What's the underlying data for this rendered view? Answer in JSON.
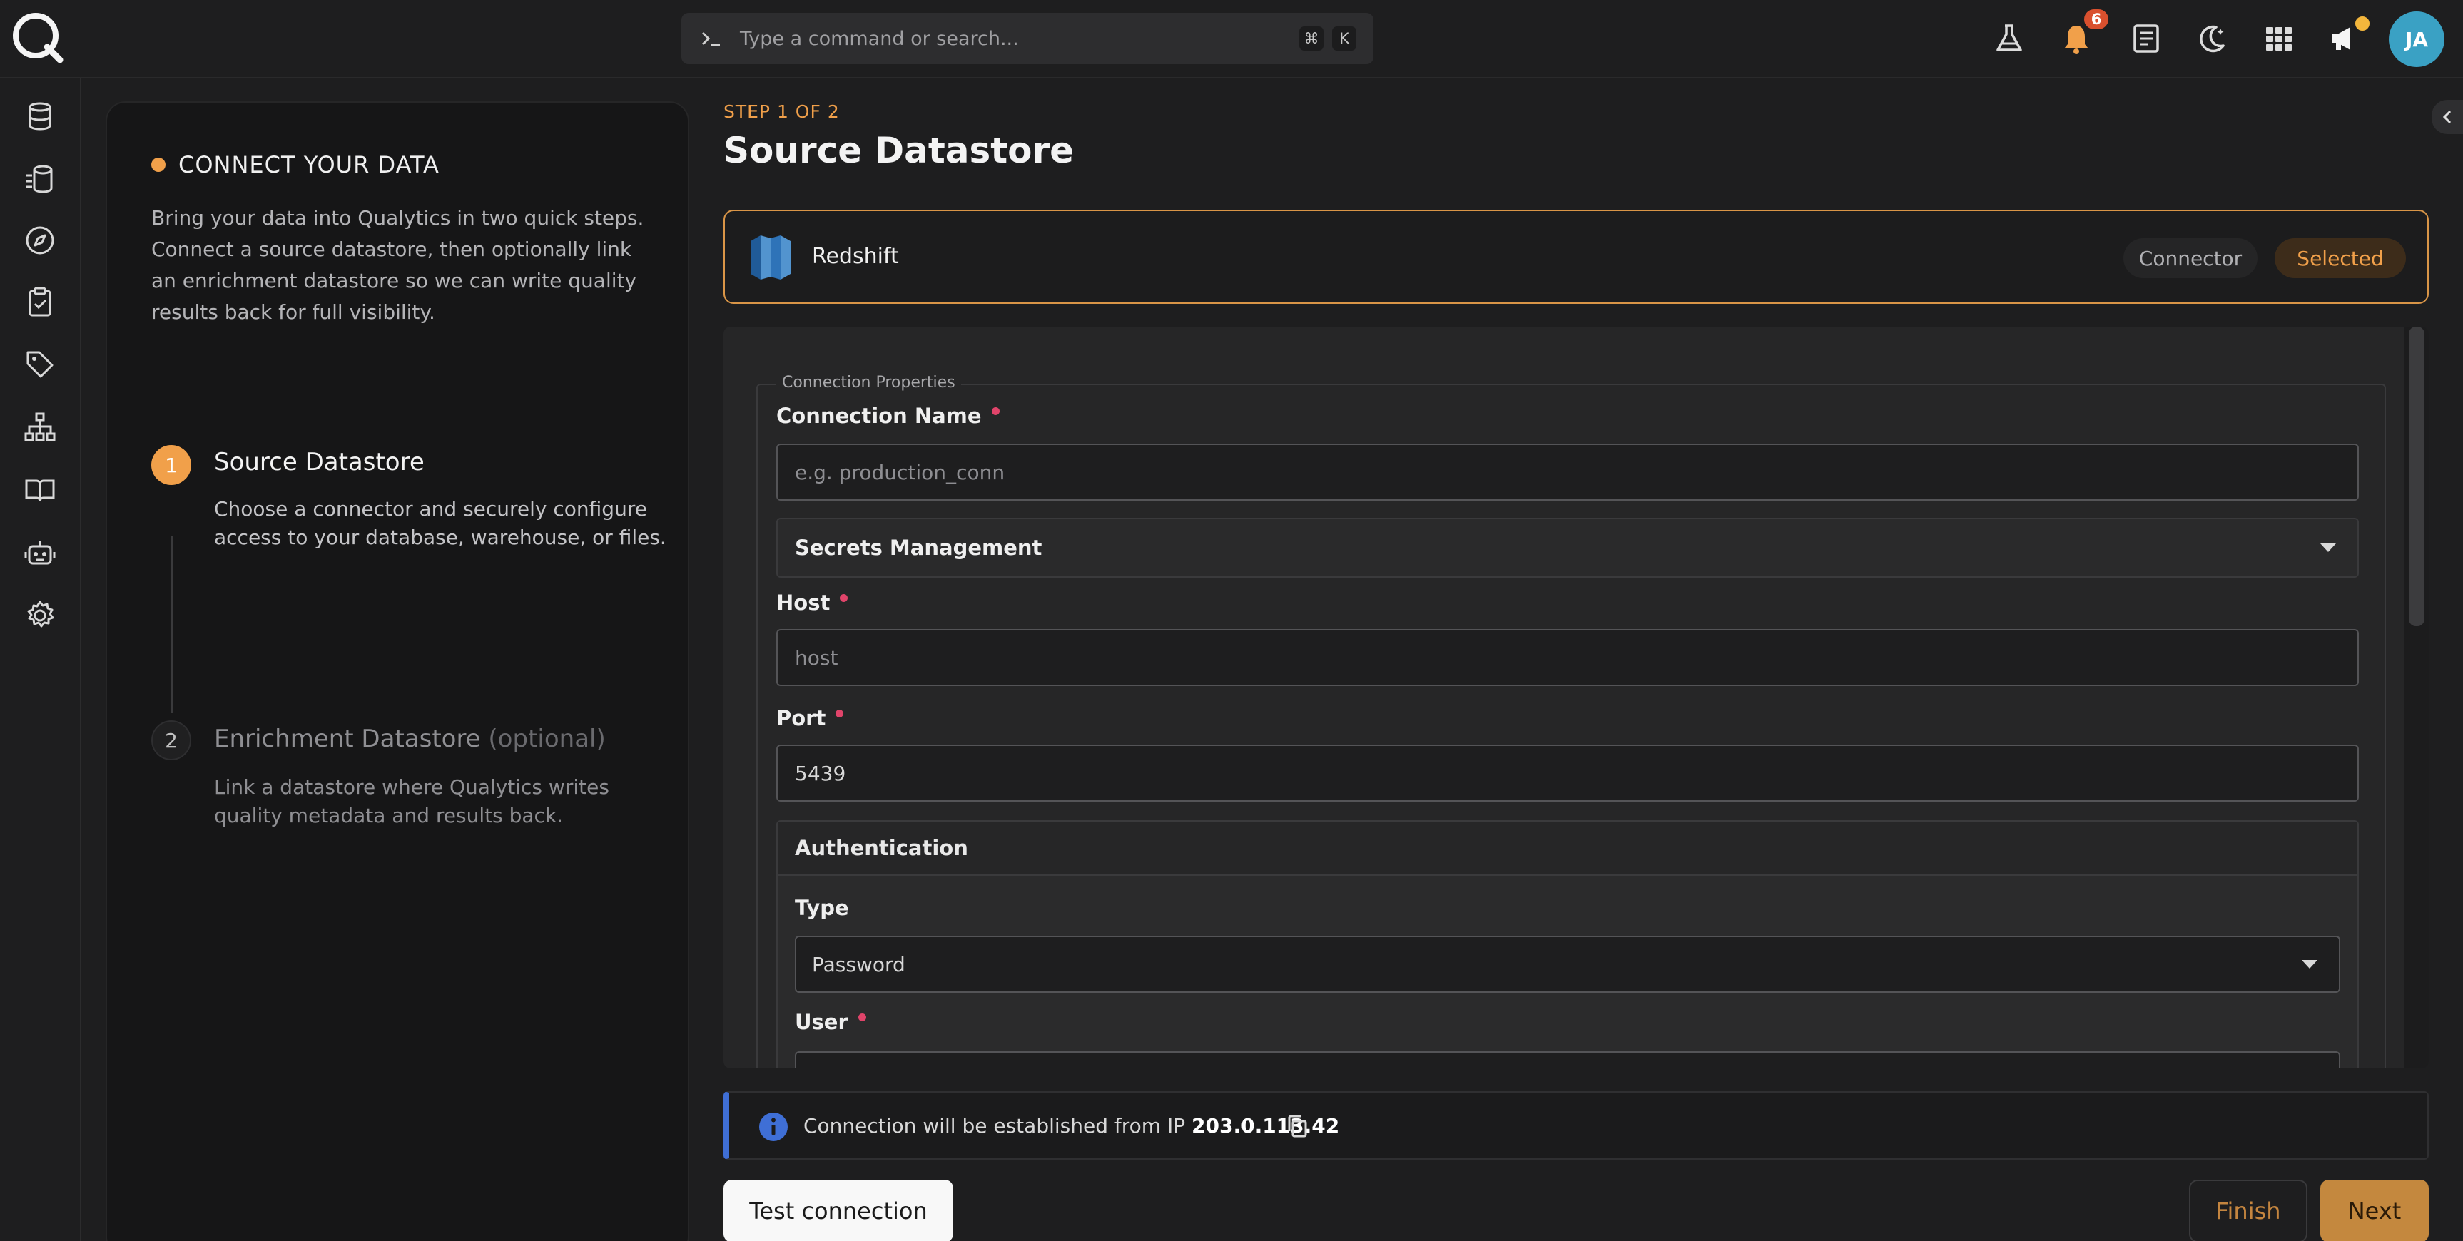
{
  "topbar": {
    "search_placeholder": "Type a command or search...",
    "shortcut_keys": [
      "⌘",
      "K"
    ],
    "notification_count": "6",
    "avatar_initials": "JA"
  },
  "left_panel": {
    "heading": "CONNECT YOUR DATA",
    "description": "Bring your data into Qualytics in two quick steps. Connect a source datastore, then optionally link an enrichment datastore so we can write quality results back for full visibility.",
    "steps": [
      {
        "number": "1",
        "title": "Source Datastore",
        "optional": "",
        "description": "Choose a connector and securely configure access to your database, warehouse, or files."
      },
      {
        "number": "2",
        "title": "Enrichment Datastore",
        "optional": "(optional)",
        "description": "Link a datastore where Qualytics writes quality metadata and results back."
      }
    ]
  },
  "main": {
    "step_label": "STEP 1 OF 2",
    "title": "Source Datastore",
    "connector": {
      "name": "Redshift",
      "type_label": "Connector",
      "status_label": "Selected"
    },
    "form": {
      "legend": "Connection Properties",
      "connection_name_label": "Connection Name",
      "connection_name_placeholder": "e.g. production_conn",
      "secrets_label": "Secrets Management",
      "host_label": "Host",
      "host_placeholder": "host",
      "port_label": "Port",
      "port_value": "5439",
      "auth_heading": "Authentication",
      "type_label": "Type",
      "type_value": "Password",
      "user_label": "User"
    },
    "info": {
      "text": "Connection will be established from IP",
      "ip": "203.0.113.42"
    },
    "buttons": {
      "test": "Test connection",
      "finish": "Finish",
      "next": "Next"
    }
  },
  "colors": {
    "accent": "#f1a04a",
    "info_blue": "#3f6fd6",
    "required": "#e0446a",
    "avatar": "#3aa1c4"
  }
}
